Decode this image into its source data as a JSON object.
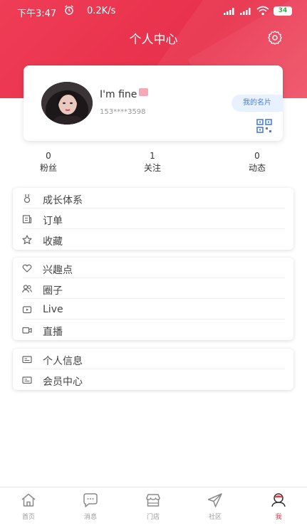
{
  "status_bar": {
    "time": "下午3:47",
    "speed": "0.2K/s",
    "battery": "34"
  },
  "header": {
    "title": "个人中心"
  },
  "profile": {
    "name": "I'm fine",
    "phone": "153****3598",
    "card_button": "我的名片"
  },
  "stats": [
    {
      "value": "0",
      "label": "粉丝"
    },
    {
      "value": "1",
      "label": "关注"
    },
    {
      "value": "0",
      "label": "动态"
    }
  ],
  "menu_groups": [
    [
      {
        "label": "成长体系",
        "icon": "medal-icon"
      },
      {
        "label": "订单",
        "icon": "order-icon"
      },
      {
        "label": "收藏",
        "icon": "star-icon"
      }
    ],
    [
      {
        "label": "兴趣点",
        "icon": "heart-icon"
      },
      {
        "label": "圈子",
        "icon": "people-icon"
      },
      {
        "label": "Live",
        "icon": "live-icon"
      },
      {
        "label": "直播",
        "icon": "camera-icon"
      }
    ],
    [
      {
        "label": "个人信息",
        "icon": "id-card-icon"
      },
      {
        "label": "会员中心",
        "icon": "member-card-icon"
      }
    ]
  ],
  "tabs": [
    {
      "label": "首页",
      "icon": "home-icon"
    },
    {
      "label": "消息",
      "icon": "message-icon"
    },
    {
      "label": "门店",
      "icon": "store-icon"
    },
    {
      "label": "社区",
      "icon": "send-icon"
    },
    {
      "label": "我",
      "icon": "user-icon",
      "active": true
    }
  ],
  "colors": {
    "brand": "#e8304b",
    "active_tab": "#e23b4c",
    "card_button_bg": "#e8f1ff",
    "card_button_text": "#4a7fd4"
  }
}
